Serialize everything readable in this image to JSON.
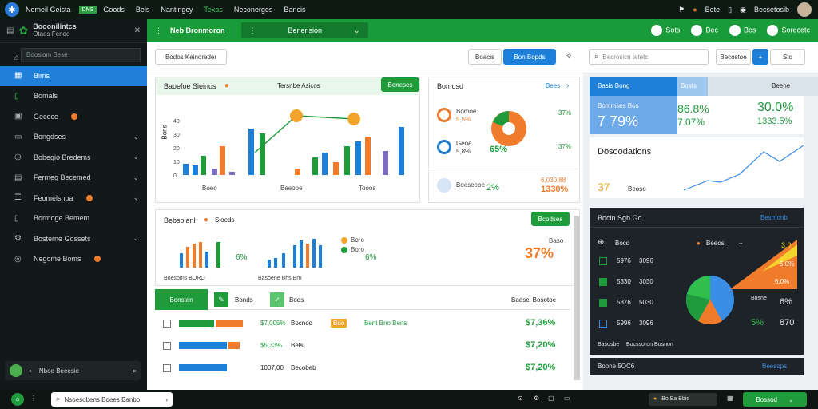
{
  "topbar": {
    "app_name": "Nemeil Geista",
    "badge": "DNS",
    "nav": [
      "Goods",
      "Bels",
      "Nantingcy",
      "Texas",
      "Neconerges",
      "Bancis"
    ],
    "active_nav": "Texas",
    "right": [
      "Bete",
      "Becsetosib"
    ]
  },
  "sidebar": {
    "brand_line1": "Booonilintcs",
    "brand_line2": "Otaos Fenoo",
    "search_placeholder": "Boosiom Bese",
    "items": [
      {
        "label": "Bims",
        "icon": "chart-icon"
      },
      {
        "label": "Bomals",
        "icon": "document-icon"
      },
      {
        "label": "Gecoce",
        "icon": "grid-icon"
      },
      {
        "label": "Bongdses",
        "icon": "folder-icon"
      },
      {
        "label": "Bobegio Bredems",
        "icon": "clock-icon"
      },
      {
        "label": "Fermeg Becemed",
        "icon": "calendar-icon"
      },
      {
        "label": "Feomelsnba",
        "icon": "list-icon"
      },
      {
        "label": "Bormoge Bemem",
        "icon": "document-icon"
      },
      {
        "label": "Bosterne Gossets",
        "icon": "settings-icon"
      },
      {
        "label": "Negome Boms",
        "icon": "globe-icon"
      }
    ],
    "footer_label": "Nboe Beeesie"
  },
  "greenbar": {
    "title": "Neb Bronmoron",
    "select_value": "Benerision",
    "right": [
      "Sots",
      "Bec",
      "Bos",
      "Sorecetc"
    ]
  },
  "toolbar": {
    "filter_label": "Bodos Keinoreder",
    "btn1": "Boacis",
    "btn2": "Bon Bopds",
    "search_placeholder": "Becrosicn tetetc",
    "sort_label": "Becostoe",
    "btn3": "Sto"
  },
  "card1": {
    "title": "Baoefoe Sieinos",
    "subtitle": "Tersnbe Asicos",
    "button": "Beneses",
    "xlabels": [
      "Boeo",
      "Beeooe",
      "Tooos"
    ],
    "ylabel": "Bons",
    "yticks": [
      "0",
      "10",
      "20",
      "30",
      "40"
    ]
  },
  "card2": {
    "title": "Bomosd",
    "link": "Bees",
    "items": [
      {
        "label": "Bomoe",
        "value": "5,5%"
      },
      {
        "label": "Geoe",
        "value": "5,8%"
      }
    ],
    "pct_big": "65%",
    "pct_a": "37%",
    "pct_b": "37%",
    "foot_label": "Boeseeoe",
    "foot_pct": "2%",
    "foot_value1": "6,030,88",
    "foot_value2": "1330%"
  },
  "card3": {
    "title": "Bebsoianl",
    "subtitle": "Sioeds",
    "button": "Bcodses",
    "pct_a": "6%",
    "pct_b": "6%",
    "labels": [
      "Boro",
      "Boro"
    ],
    "right_label": "Baso",
    "right_value": "37%",
    "foot_left": "Boesoms BORO",
    "foot_right": "Basoene Bhs Bro"
  },
  "table": {
    "tab1": "Bonsten",
    "tab2": "Bonds",
    "tab3": "Bods",
    "right_header": "Baesel Bosotoe",
    "rows": [
      {
        "value1": "$7,005%",
        "label": "Bocnod",
        "tag": "Bdo",
        "name": "Bent Bno Bens",
        "amount": "$7,36%"
      },
      {
        "value1": "$5,33%",
        "label": "Bels",
        "tag": "",
        "name": "",
        "amount": "$7,20%"
      },
      {
        "value1": "1007,00",
        "label": "Becobeb",
        "tag": "",
        "name": "",
        "amount": "$7,20%"
      }
    ]
  },
  "rp": {
    "tabs": [
      "Basis Bong",
      "Bosts",
      "Beene"
    ],
    "m1_label": "Bommses Bos",
    "m1_value": "7 79%",
    "m2_value": "86.8%",
    "m2_sub": "7.07%",
    "m3_value": "30.0%",
    "m3_sub": "1333.5%",
    "trend_title": "Dosoodations",
    "trend_value": "37",
    "trend_label": "Beoso"
  },
  "dark_panel": {
    "title": "Bocin Sgb Go",
    "link": "Besmonb",
    "filter_label": "Bocd",
    "filter2": "Beeos",
    "rows": [
      {
        "a": "5976",
        "b": "3096"
      },
      {
        "a": "5330",
        "b": "3030"
      },
      {
        "a": "5376",
        "b": "5030"
      },
      {
        "a": "5996",
        "b": "3096"
      }
    ],
    "pct_a": "3.0",
    "pct_b": "5.0%",
    "pct_c": "6.0%",
    "mid_label": "Bosne",
    "mid_value": "6%",
    "mid_pct": "5%",
    "mid_val2": "870",
    "foot_left": "Basosbe",
    "foot_mid": "Bocssoron Bosnon",
    "foot_btn": "Boone 5OC6",
    "foot_link": "Beesops"
  },
  "bottombar": {
    "search_text": "Nsoesobens Boees Banbo",
    "right_label": "Bo Ba Bbis",
    "button": "Bossod"
  },
  "colors": {
    "green": "#1f9b3c",
    "blue": "#1e7fd8",
    "orange": "#f07b2b",
    "purple": "#7e6bc4"
  }
}
